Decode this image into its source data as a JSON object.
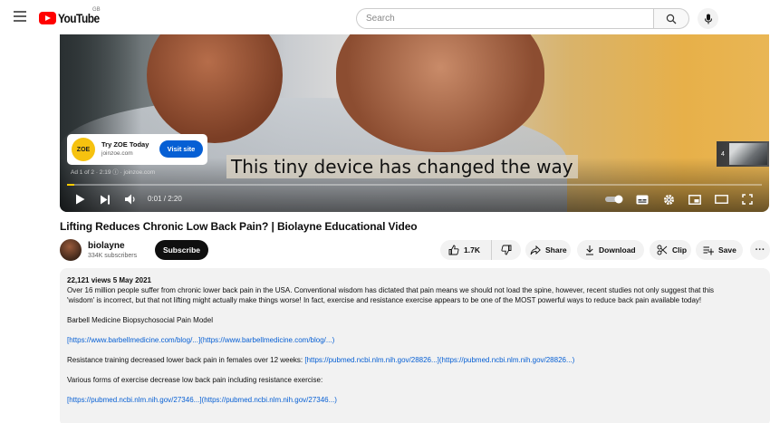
{
  "header": {
    "logo_text": "YouTube",
    "region": "GB",
    "search_placeholder": "Search"
  },
  "player": {
    "caption": "This tiny device has changed the way",
    "ad": {
      "title": "Try ZOE Today",
      "domain": "joinzoe.com",
      "logo_text": "ZOE",
      "visit_label": "Visit site",
      "meta": "Ad 1 of 2 · 2:19 ⓘ · joinzoe.com"
    },
    "skip_count": "4",
    "time": "0:01 / 2:20",
    "progress": 0.01,
    "accent_color": "#ffcc00"
  },
  "video": {
    "title": "Lifting Reduces Chronic Low Back Pain? | Biolayne Educational Video"
  },
  "channel": {
    "name": "biolayne",
    "subscribers": "334K subscribers",
    "subscribe_label": "Subscribe"
  },
  "actions": {
    "likes": "1.7K",
    "share": "Share",
    "download": "Download",
    "clip": "Clip",
    "save": "Save",
    "more": "···"
  },
  "description": {
    "stats": "22,121 views  5 May 2021",
    "line1": "Over 16 million people suffer from chronic lower back pain in the USA. Conventional wisdom has dictated that pain means we should not load the spine, however, recent studies not only suggest that this",
    "line2": "'wisdom' is incorrect, but that not lifting might actually make things worse! In fact, exercise and resistance exercise appears to be one of the MOST powerful ways to reduce back pain available today!",
    "heading1": "Barbell Medicine Biopsychosocial Pain Model",
    "link1": "[https://www.barbellmedicine.com/blog/...](https://www.barbellmedicine.com/blog/...)",
    "item2_text": "Resistance training decreased lower back pain in females over 12 weeks: ",
    "item2_link": "[https://pubmed.ncbi.nlm.nih.gov/28826...](https://pubmed.ncbi.nlm.nih.gov/28826...)",
    "heading3": "Various forms of exercise decrease low back pain including resistance exercise:",
    "link3": "[https://pubmed.ncbi.nlm.nih.gov/27346...](https://pubmed.ncbi.nlm.nih.gov/27346...)"
  }
}
